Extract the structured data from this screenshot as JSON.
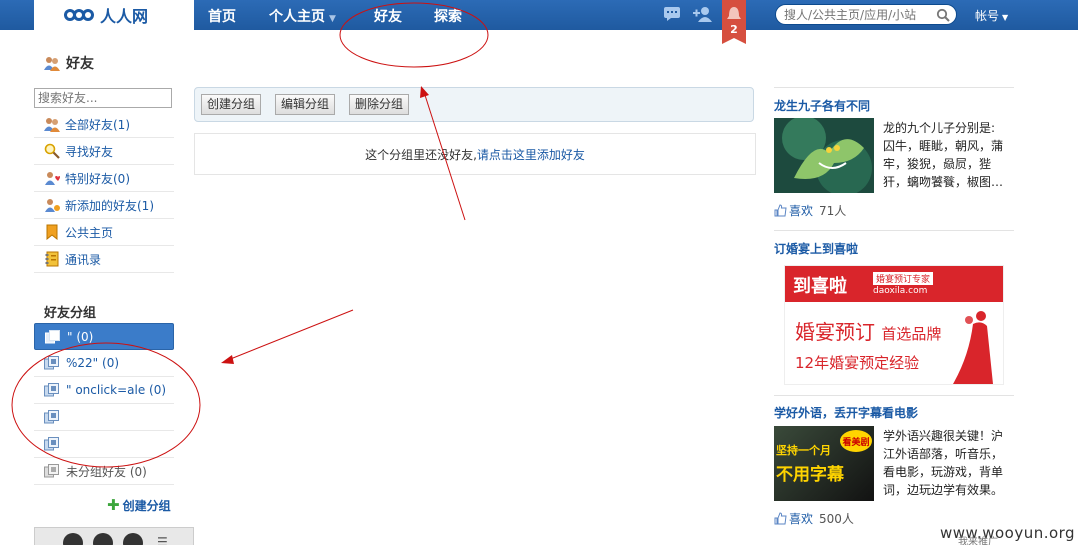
{
  "topnav": {
    "logo_text": "人人网",
    "items": [
      {
        "label": "首页"
      },
      {
        "label": "个人主页"
      },
      {
        "label": "好友"
      },
      {
        "label": "探索"
      }
    ],
    "notification_count": "2",
    "search_placeholder": "搜人/公共主页/应用/小站",
    "account_label": "帐号"
  },
  "sidebar": {
    "title": "好友",
    "search_placeholder": "搜索好友...",
    "menu": [
      {
        "label": "全部好友(1)",
        "icon": "friends-icon"
      },
      {
        "label": "寻找好友",
        "icon": "magnifier-icon"
      },
      {
        "label": "特别好友(0)",
        "icon": "heart-friend-icon"
      },
      {
        "label": "新添加的好友(1)",
        "icon": "new-friend-icon"
      },
      {
        "label": "公共主页",
        "icon": "bookmark-icon"
      },
      {
        "label": "通讯录",
        "icon": "address-book-icon"
      }
    ],
    "groups_title": "好友分组",
    "groups": [
      {
        "label": "\" (0)",
        "active": true
      },
      {
        "label": "%22\" (0)",
        "active": false
      },
      {
        "label": "\" onclick=ale (0)",
        "active": false
      },
      {
        "label": "",
        "active": false
      },
      {
        "label": "",
        "active": false
      },
      {
        "label": "未分组好友 (0)",
        "active": false
      }
    ],
    "create_group_label": "创建分组"
  },
  "main": {
    "buttons": {
      "create": "创建分组",
      "edit": "编辑分组",
      "delete": "删除分组"
    },
    "empty_text": "这个分组里还没好友,",
    "empty_link": "请点击这里添加好友"
  },
  "right": {
    "ad1": {
      "title": "龙生九子各有不同",
      "desc": "龙的九个儿子分别是:囚牛，睚眦，朝风，蒲牢，狻猊，赑屃，狴犴，螭吻饕餮，椒图…",
      "like_label": "喜欢",
      "like_count": "71人"
    },
    "ad2": {
      "title": "订婚宴上到喜啦",
      "banner_brand": "到喜啦",
      "banner_tag": "婚宴预订专家",
      "banner_url": "daoxila.com",
      "banner_line1": "婚宴预订",
      "banner_line1b": "首选品牌",
      "banner_line2": "12年婚宴预定经验"
    },
    "ad3": {
      "title": "学好外语，丢开字幕看电影",
      "desc": "学外语兴趣很关键！沪江外语部落，听音乐，看电影，玩游戏，背单词，边玩边学有效果。",
      "img_text1": "坚持一个月",
      "img_text2": "不用字幕",
      "img_badge": "看美剧",
      "like_label": "喜欢",
      "like_count": "500人"
    }
  },
  "watermark": "www.wooyun.org",
  "watermark_sub": "我来推广",
  "colors": {
    "nav_blue": "#1f5aa0",
    "link_blue": "#1b5aa5",
    "active_group": "#3b7cc9",
    "annotation_red": "#cc1111"
  }
}
